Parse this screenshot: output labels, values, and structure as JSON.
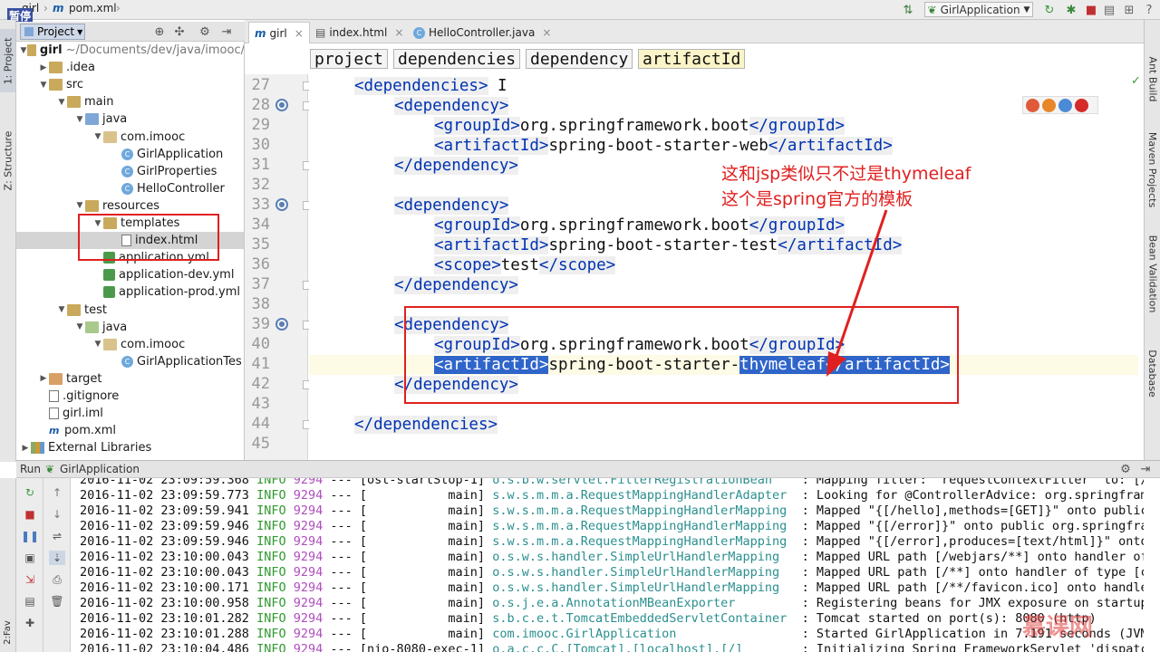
{
  "navbar": {
    "crumb_project": "girl",
    "crumb_file": "pom.xml",
    "run_config": "GirlApplication",
    "paused_label": "暂停"
  },
  "left_strip": {
    "tab_project": "1: Project",
    "tab_structure": "Z: Structure"
  },
  "right_strip": {
    "tab_ant": "Ant Build",
    "tab_maven": "Maven Projects",
    "tab_bean": "Bean Validation",
    "tab_database": "Database"
  },
  "project_panel": {
    "header_label": "Project",
    "tree": [
      {
        "label": "girl",
        "suffix": "~/Documents/dev/java/imooc/",
        "depth": 0,
        "icon": "folder-icon",
        "expanded": true
      },
      {
        "label": ".idea",
        "depth": 1,
        "icon": "folder-icon",
        "expanded": false
      },
      {
        "label": "src",
        "depth": 1,
        "icon": "folder-icon",
        "expanded": true
      },
      {
        "label": "main",
        "depth": 2,
        "icon": "folder-icon",
        "expanded": true
      },
      {
        "label": "java",
        "depth": 3,
        "icon": "source-folder-icon",
        "expanded": true
      },
      {
        "label": "com.imooc",
        "depth": 4,
        "icon": "package-icon",
        "expanded": true
      },
      {
        "label": "GirlApplication",
        "depth": 5,
        "icon": "spring-class-icon"
      },
      {
        "label": "GirlProperties",
        "depth": 5,
        "icon": "class-icon"
      },
      {
        "label": "HelloController",
        "depth": 5,
        "icon": "class-icon"
      },
      {
        "label": "resources",
        "depth": 3,
        "icon": "resources-folder-icon",
        "expanded": true
      },
      {
        "label": "templates",
        "depth": 4,
        "icon": "folder-icon",
        "expanded": true
      },
      {
        "label": "index.html",
        "depth": 5,
        "icon": "html-file-icon",
        "selected": true
      },
      {
        "label": "application.yml",
        "depth": 4,
        "icon": "yml-file-icon"
      },
      {
        "label": "application-dev.yml",
        "depth": 4,
        "icon": "yml-file-icon"
      },
      {
        "label": "application-prod.yml",
        "depth": 4,
        "icon": "yml-file-icon"
      },
      {
        "label": "test",
        "depth": 2,
        "icon": "folder-icon",
        "expanded": true
      },
      {
        "label": "java",
        "depth": 3,
        "icon": "test-source-folder-icon",
        "expanded": true
      },
      {
        "label": "com.imooc",
        "depth": 4,
        "icon": "package-icon",
        "expanded": true
      },
      {
        "label": "GirlApplicationTes",
        "depth": 5,
        "icon": "spring-class-icon"
      },
      {
        "label": "target",
        "depth": 1,
        "icon": "excluded-folder-icon",
        "expanded": false
      },
      {
        "label": ".gitignore",
        "depth": 1,
        "icon": "text-file-icon"
      },
      {
        "label": "girl.iml",
        "depth": 1,
        "icon": "iml-file-icon"
      },
      {
        "label": "pom.xml",
        "depth": 1,
        "icon": "maven-file-icon"
      },
      {
        "label": "External Libraries",
        "depth": 0,
        "icon": "libraries-icon",
        "expanded": false
      }
    ]
  },
  "editor": {
    "tabs": [
      {
        "label": "girl",
        "icon": "maven-file-icon",
        "active": true
      },
      {
        "label": "index.html",
        "icon": "html-file-icon",
        "active": false
      },
      {
        "label": "HelloController.java",
        "icon": "class-icon",
        "active": false
      }
    ],
    "breadcrumbs": [
      "project",
      "dependencies",
      "dependency",
      "artifactId"
    ],
    "lines": [
      {
        "n": "27",
        "indent": 2,
        "parts": [
          {
            "t": "<dependencies>",
            "c": "tag"
          },
          {
            "t": " I",
            "c": ""
          }
        ]
      },
      {
        "n": "28",
        "indent": 4,
        "parts": [
          {
            "t": "<dependency>",
            "c": "tag"
          }
        ]
      },
      {
        "n": "29",
        "indent": 6,
        "parts": [
          {
            "t": "<groupId>",
            "c": "tag"
          },
          {
            "t": "org.springframework.boot",
            "c": ""
          },
          {
            "t": "</groupId>",
            "c": "tag"
          }
        ]
      },
      {
        "n": "30",
        "indent": 6,
        "parts": [
          {
            "t": "<artifactId>",
            "c": "tag"
          },
          {
            "t": "spring-boot-starter-web",
            "c": ""
          },
          {
            "t": "</artifactId>",
            "c": "tag"
          }
        ]
      },
      {
        "n": "31",
        "indent": 4,
        "parts": [
          {
            "t": "</dependency>",
            "c": "tag"
          }
        ]
      },
      {
        "n": "32",
        "indent": 0,
        "parts": []
      },
      {
        "n": "33",
        "indent": 4,
        "parts": [
          {
            "t": "<dependency>",
            "c": "tag"
          }
        ]
      },
      {
        "n": "34",
        "indent": 6,
        "parts": [
          {
            "t": "<groupId>",
            "c": "tag"
          },
          {
            "t": "org.springframework.boot",
            "c": ""
          },
          {
            "t": "</groupId>",
            "c": "tag"
          }
        ]
      },
      {
        "n": "35",
        "indent": 6,
        "parts": [
          {
            "t": "<artifactId>",
            "c": "tag"
          },
          {
            "t": "spring-boot-starter-test",
            "c": ""
          },
          {
            "t": "</artifactId>",
            "c": "tag"
          }
        ]
      },
      {
        "n": "36",
        "indent": 6,
        "parts": [
          {
            "t": "<scope>",
            "c": "tag"
          },
          {
            "t": "test",
            "c": ""
          },
          {
            "t": "</scope>",
            "c": "tag"
          }
        ]
      },
      {
        "n": "37",
        "indent": 4,
        "parts": [
          {
            "t": "</dependency>",
            "c": "tag"
          }
        ]
      },
      {
        "n": "38",
        "indent": 0,
        "parts": []
      },
      {
        "n": "39",
        "indent": 4,
        "parts": [
          {
            "t": "<dependency>",
            "c": "tag"
          }
        ]
      },
      {
        "n": "40",
        "indent": 6,
        "parts": [
          {
            "t": "<groupId>",
            "c": "tag"
          },
          {
            "t": "org.springframework.boot",
            "c": ""
          },
          {
            "t": "</groupId>",
            "c": "tag"
          }
        ]
      },
      {
        "n": "41",
        "indent": 6,
        "current": true,
        "parts": [
          {
            "t": "<artifactId>",
            "c": "hl"
          },
          {
            "t": "spring-boot-starter-",
            "c": ""
          },
          {
            "t": "thymeleaf",
            "c": "hlt"
          },
          {
            "t": "</artifactId>",
            "c": "hl"
          }
        ]
      },
      {
        "n": "42",
        "indent": 4,
        "parts": [
          {
            "t": "</dependency>",
            "c": "tag"
          }
        ]
      },
      {
        "n": "43",
        "indent": 0,
        "parts": []
      },
      {
        "n": "44",
        "indent": 2,
        "parts": [
          {
            "t": "</dependencies>",
            "c": "tag"
          }
        ]
      },
      {
        "n": "45",
        "indent": 0,
        "parts": []
      }
    ],
    "annotation_line1": "这和jsp类似只不过是thymeleaf",
    "annotation_line2": "这个是spring官方的模板"
  },
  "run_panel": {
    "label": "Run",
    "config": "GirlApplication",
    "logs": [
      {
        "ts": "2016-11-02 23:09:59.368",
        "lv": "INFO",
        "pid": "9294",
        "thread": "[ost-startStop-1]",
        "logger": "o.s.b.w.servlet.FilterRegistrationBean",
        "msg": ": Mapping filter: 'requestContextFilter' to: [/*"
      },
      {
        "ts": "2016-11-02 23:09:59.773",
        "lv": "INFO",
        "pid": "9294",
        "thread": "[           main]",
        "logger": "s.w.s.m.m.a.RequestMappingHandlerAdapter",
        "msg": ": Looking for @ControllerAdvice: org.springframe"
      },
      {
        "ts": "2016-11-02 23:09:59.941",
        "lv": "INFO",
        "pid": "9294",
        "thread": "[           main]",
        "logger": "s.w.s.m.m.a.RequestMappingHandlerMapping",
        "msg": ": Mapped \"{[/hello],methods=[GET]}\" onto public"
      },
      {
        "ts": "2016-11-02 23:09:59.946",
        "lv": "INFO",
        "pid": "9294",
        "thread": "[           main]",
        "logger": "s.w.s.m.m.a.RequestMappingHandlerMapping",
        "msg": ": Mapped \"{[/error]}\" onto public org.springfram"
      },
      {
        "ts": "2016-11-02 23:09:59.946",
        "lv": "INFO",
        "pid": "9294",
        "thread": "[           main]",
        "logger": "s.w.s.m.m.a.RequestMappingHandlerMapping",
        "msg": ": Mapped \"{[/error],produces=[text/html]}\" onto"
      },
      {
        "ts": "2016-11-02 23:10:00.043",
        "lv": "INFO",
        "pid": "9294",
        "thread": "[           main]",
        "logger": "o.s.w.s.handler.SimpleUrlHandlerMapping",
        "msg": ": Mapped URL path [/webjars/**] onto handler of"
      },
      {
        "ts": "2016-11-02 23:10:00.043",
        "lv": "INFO",
        "pid": "9294",
        "thread": "[           main]",
        "logger": "o.s.w.s.handler.SimpleUrlHandlerMapping",
        "msg": ": Mapped URL path [/**] onto handler of type [cl"
      },
      {
        "ts": "2016-11-02 23:10:00.171",
        "lv": "INFO",
        "pid": "9294",
        "thread": "[           main]",
        "logger": "o.s.w.s.handler.SimpleUrlHandlerMapping",
        "msg": ": Mapped URL path [/**/favicon.ico] onto handler"
      },
      {
        "ts": "2016-11-02 23:10:00.958",
        "lv": "INFO",
        "pid": "9294",
        "thread": "[           main]",
        "logger": "o.s.j.e.a.AnnotationMBeanExporter",
        "msg": ": Registering beans for JMX exposure on startup"
      },
      {
        "ts": "2016-11-02 23:10:01.282",
        "lv": "INFO",
        "pid": "9294",
        "thread": "[           main]",
        "logger": "s.b.c.e.t.TomcatEmbeddedServletContainer",
        "msg": ": Tomcat started on port(s): 8080 (http)"
      },
      {
        "ts": "2016-11-02 23:10:01.288",
        "lv": "INFO",
        "pid": "9294",
        "thread": "[           main]",
        "logger": "com.imooc.GirlApplication",
        "msg": ": Started GirlApplication in 7.191 seconds (JVM"
      },
      {
        "ts": "2016-11-02 23:10:04.486",
        "lv": "INFO",
        "pid": "9294",
        "thread": "[nio-8080-exec-1]",
        "logger": "o.a.c.c.C.[Tomcat].[localhost].[/]",
        "msg": ": Initializing Spring FrameworkServlet 'dispatch"
      }
    ]
  },
  "watermark": "慕课网",
  "colors": {
    "tag": "#0033b3",
    "highlight": "#2f65ca",
    "annotation": "#e02020",
    "log_level": "#2f9a2f",
    "log_pid": "#b04dbf",
    "log_logger": "#2c8f8f"
  }
}
